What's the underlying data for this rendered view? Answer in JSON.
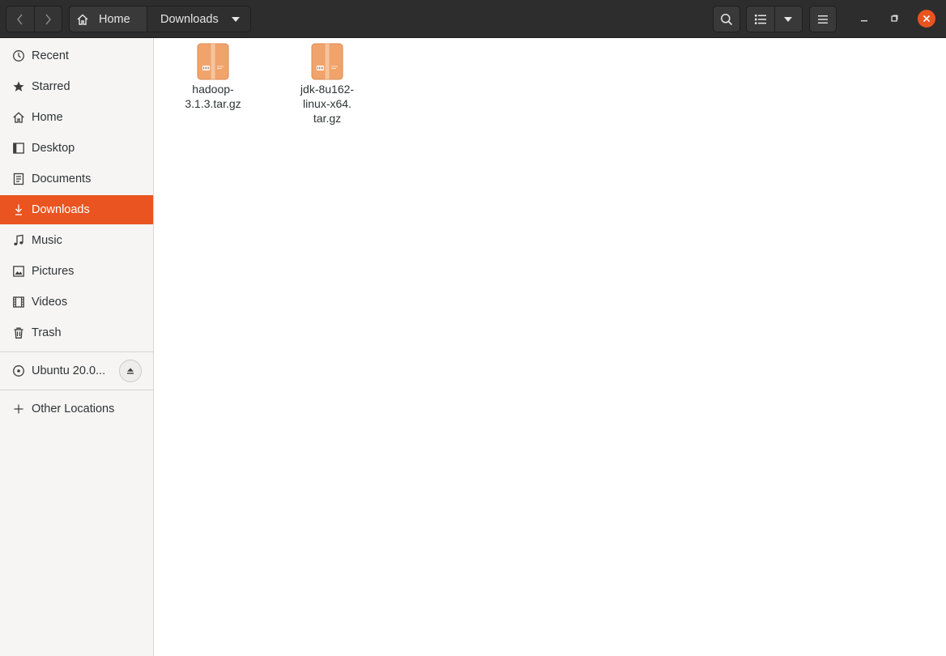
{
  "header": {
    "path": [
      {
        "label": "Home",
        "icon": "home-icon"
      },
      {
        "label": "Downloads",
        "icon": "chevron-down-icon"
      }
    ],
    "buttons": [
      "back-icon",
      "forward-icon",
      "search-icon",
      "list-view-icon",
      "view-options-icon",
      "menu-icon",
      "minimize-icon",
      "maximize-icon",
      "close-icon"
    ]
  },
  "sidebar": {
    "items": [
      {
        "label": "Recent",
        "icon": "clock-icon"
      },
      {
        "label": "Starred",
        "icon": "star-icon"
      },
      {
        "label": "Home",
        "icon": "home-icon"
      },
      {
        "label": "Desktop",
        "icon": "desktop-icon"
      },
      {
        "label": "Documents",
        "icon": "document-icon"
      },
      {
        "label": "Downloads",
        "icon": "download-icon"
      },
      {
        "label": "Music",
        "icon": "music-icon"
      },
      {
        "label": "Pictures",
        "icon": "picture-icon"
      },
      {
        "label": "Videos",
        "icon": "video-icon"
      },
      {
        "label": "Trash",
        "icon": "trash-icon"
      }
    ],
    "active": "Downloads",
    "devices": [
      {
        "label": "Ubuntu 20.0...",
        "icon": "disc-icon",
        "action": "eject-icon"
      }
    ],
    "other": {
      "label": "Other Locations",
      "icon": "plus-icon"
    }
  },
  "files": [
    {
      "name": "hadoop-\n3.1.3.tar.gz",
      "icon": "archive-icon"
    },
    {
      "name": "jdk-8u162-\nlinux-x64.\ntar.gz",
      "icon": "archive-icon"
    }
  ],
  "colors": {
    "accent": "#e95420",
    "header_bg": "#2d2d2d",
    "sidebar_bg": "#f6f5f4",
    "archive_icon": "#f0a46c"
  }
}
